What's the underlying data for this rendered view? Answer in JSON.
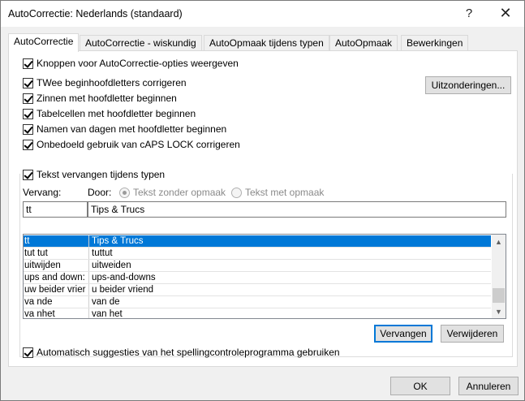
{
  "window": {
    "title": "AutoCorrectie: Nederlands (standaard)",
    "help_glyph": "?",
    "close_glyph": "✕"
  },
  "tabs": [
    {
      "label": "AutoCorrectie",
      "active": true
    },
    {
      "label": "AutoCorrectie - wiskundig",
      "active": false
    },
    {
      "label": "AutoOpmaak tijdens typen",
      "active": false
    },
    {
      "label": "AutoOpmaak",
      "active": false
    },
    {
      "label": "Bewerkingen",
      "active": false
    }
  ],
  "options": {
    "show_buttons": {
      "label": "Knoppen voor AutoCorrectie-opties weergeven",
      "checked": true
    },
    "two_caps": {
      "label": "TWee beginhoofdletters corrigeren",
      "checked": true
    },
    "sentence_caps": {
      "label": "Zinnen met hoofdletter beginnen",
      "checked": true
    },
    "table_caps": {
      "label": "Tabelcellen met hoofdletter beginnen",
      "checked": true
    },
    "day_names": {
      "label": "Namen van dagen met hoofdletter beginnen",
      "checked": true
    },
    "caps_lock": {
      "label": "Onbedoeld gebruik van cAPS LOCK corrigeren",
      "checked": true
    },
    "replace_typing": {
      "label": "Tekst vervangen tijdens typen",
      "checked": true
    },
    "auto_suggest": {
      "label": "Automatisch suggesties van het spellingcontroleprogramma gebruiken",
      "checked": true
    }
  },
  "exceptions_button": "Uitzonderingen...",
  "replace": {
    "replace_label": "Vervang:",
    "with_label": "Door:",
    "plain_text_label": "Tekst zonder opmaak",
    "formatted_text_label": "Tekst met opmaak",
    "replace_value": "tt",
    "with_value": "Tips & Trucs"
  },
  "entries": [
    {
      "from": "tt",
      "to": "Tips & Trucs"
    },
    {
      "from": "tut tut",
      "to": "tuttut"
    },
    {
      "from": "uitwijden",
      "to": "uitweiden"
    },
    {
      "from": "ups and down:",
      "to": "ups-and-downs"
    },
    {
      "from": "uw beider vrier",
      "to": "u beider vriend"
    },
    {
      "from": "va nde",
      "to": "van de"
    },
    {
      "from": "va nhet",
      "to": "van het"
    }
  ],
  "buttons": {
    "replace": "Vervangen",
    "delete": "Verwijderen",
    "ok": "OK",
    "cancel": "Annuleren"
  },
  "colors": {
    "selection": "#0078d7",
    "default_border": "#0078d7"
  }
}
